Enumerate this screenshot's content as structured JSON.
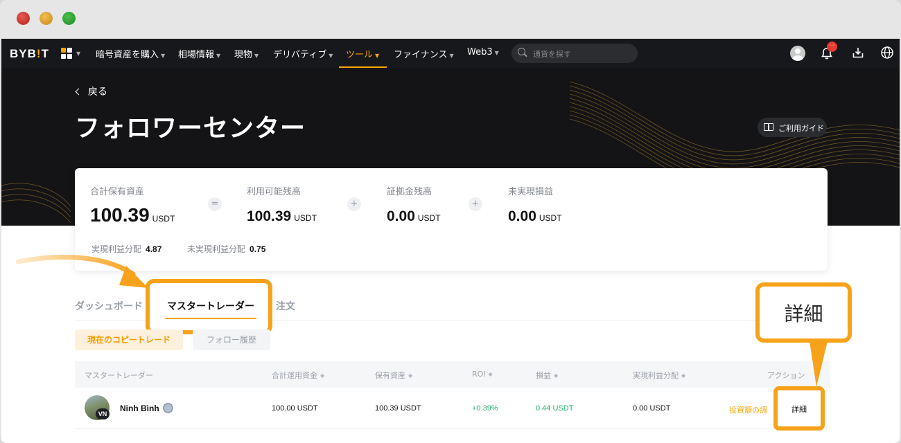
{
  "nav": {
    "logo_left": "BYB",
    "logo_bang": "!",
    "logo_right": "T",
    "items": [
      "暗号資産を購入",
      "相場情報",
      "現物",
      "デリバティブ",
      "ツール",
      "ファイナンス",
      "Web3"
    ],
    "active_item": "ツール",
    "search_placeholder": "通貨を探す",
    "badge_text": "···"
  },
  "hero": {
    "back_label": "戻る",
    "title": "フォロワーセンター",
    "guide_label": "ご利用ガイド"
  },
  "summary": {
    "total_assets_label": "合計保有資産",
    "total_assets_value": "100.39",
    "available_label": "利用可能残高",
    "available_value": "100.39",
    "margin_label": "証拠金残高",
    "margin_value": "0.00",
    "unrealized_label": "未実現損益",
    "unrealized_value": "0.00",
    "unit": "USDT",
    "op_equals": "=",
    "op_plus": "+",
    "realized_dist_label": "実現利益分配",
    "realized_dist_value": "4.87",
    "unrealized_dist_label": "未実現利益分配",
    "unrealized_dist_value": "0.75"
  },
  "tabs": {
    "dashboard": "ダッシュボード",
    "master_traders": "マスタートレーダー",
    "orders": "注文"
  },
  "filters": {
    "current_copy": "現在のコピートレード",
    "follow_history": "フォロー履歴"
  },
  "table": {
    "headers": {
      "trader": "マスタートレーダー",
      "total_funds": "合計運用資金",
      "holdings": "保有資産",
      "roi": "ROI",
      "pnl": "損益",
      "realized_dist": "実現利益分配",
      "action": "アクション"
    },
    "sort_glyph": "◆",
    "rows": [
      {
        "name": "Ninh Bình",
        "country_badge": "VN",
        "total_funds": "100.00 USDT",
        "holdings": "100.39 USDT",
        "roi": "+0.39%",
        "pnl": "0.44 USDT",
        "realized_dist": "0.00 USDT",
        "adjust_label": "投資額の調",
        "detail_label": "詳細"
      }
    ]
  },
  "annotation": {
    "detail_callout": "詳細"
  },
  "colors": {
    "brand_orange": "#f7a600",
    "callout_orange": "#f7a21b",
    "positive_green": "#20b26c",
    "nav_bg": "#17181b",
    "hero_bg": "#141416"
  }
}
